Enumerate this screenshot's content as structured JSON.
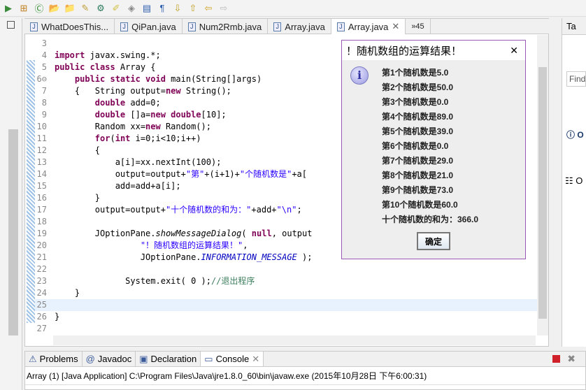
{
  "toolbar": {
    "icons": [
      "run-icon",
      "new-package-icon",
      "new-class-icon",
      "open-folder-icon",
      "open-type-icon",
      "search-icon",
      "debug-icon",
      "highlight-icon",
      "annotation-icon",
      "show-whitespace-icon",
      "next-annotation-icon",
      "prev-annotation-icon",
      "last-edit-icon",
      "back-icon",
      "forward-icon"
    ]
  },
  "editor": {
    "tabs": [
      {
        "label": "WhatDoesThis..."
      },
      {
        "label": "QiPan.java"
      },
      {
        "label": "Num2Rmb.java"
      },
      {
        "label": "Array.java"
      },
      {
        "label": "Array.java",
        "active": true
      }
    ],
    "overflow": "»45",
    "lines": [
      {
        "n": "3",
        "html": ""
      },
      {
        "n": "4",
        "html": "<span class='kw'>import</span> javax.swing.*;"
      },
      {
        "n": "5",
        "html": "<span class='kw'>public class</span> Array {"
      },
      {
        "n": "6⊖",
        "html": "    <span class='kw'>public static void</span> main(String[]args)"
      },
      {
        "n": "7",
        "html": "    {   String output=<span class='kw'>new</span> String();"
      },
      {
        "n": "8",
        "html": "        <span class='kw'>double</span> add=0;"
      },
      {
        "n": "9",
        "html": "        <span class='kw'>double</span> []a=<span class='kw'>new double</span>[10];"
      },
      {
        "n": "10",
        "html": "        Random xx=<span class='kw'>new</span> Random();"
      },
      {
        "n": "11",
        "html": "        <span class='kw'>for</span>(<span class='kw'>int</span> i=0;i&lt;10;i++)"
      },
      {
        "n": "12",
        "html": "        {"
      },
      {
        "n": "13",
        "html": "            a[i]=xx.nextInt(100);"
      },
      {
        "n": "14",
        "html": "            output=output+<span class='str'>\"第\"</span>+(i+1)+<span class='str'>\"个随机数是\"</span>+a["
      },
      {
        "n": "15",
        "html": "            add=add+a[i];"
      },
      {
        "n": "16",
        "html": "        }"
      },
      {
        "n": "17",
        "html": "        output=output+<span class='str'>\"十个随机数的和为：\"</span>+add+<span class='str'>\"\\n\"</span>;"
      },
      {
        "n": "18",
        "html": ""
      },
      {
        "n": "19",
        "html": "        JOptionPane.<span class='it'>showMessageDialog</span>( <span class='kw'>null</span>, output"
      },
      {
        "n": "20",
        "html": "                 <span class='str'>\"！随机数组的运算结果！\"</span>,"
      },
      {
        "n": "21",
        "html": "                 JOptionPane.<span class='fld'>INFORMATION_MESSAGE</span> );"
      },
      {
        "n": "22",
        "html": ""
      },
      {
        "n": "23",
        "html": "              System.exit( 0 );<span class='cm'>//退出程序</span>"
      },
      {
        "n": "24",
        "html": "    }"
      },
      {
        "n": "25",
        "html": "",
        "current": true
      },
      {
        "n": "26",
        "html": "}"
      },
      {
        "n": "27",
        "html": ""
      }
    ]
  },
  "dialog": {
    "title": "！随机数组的运算结果！",
    "close": "✕",
    "messages": [
      "第1个随机数是5.0",
      "第2个随机数是50.0",
      "第3个随机数是0.0",
      "第4个随机数是89.0",
      "第5个随机数是39.0",
      "第6个随机数是0.0",
      "第7个随机数是29.0",
      "第8个随机数是21.0",
      "第9个随机数是73.0",
      "第10个随机数是60.0",
      "十个随机数的和为：366.0"
    ],
    "ok": "确定"
  },
  "right_panel": {
    "tab": "Ta",
    "find": "Find",
    "info": "O",
    "outline": "O"
  },
  "bottom": {
    "tabs": [
      {
        "label": "Problems"
      },
      {
        "label": "Javadoc"
      },
      {
        "label": "Declaration"
      },
      {
        "label": "Console",
        "active": true
      }
    ],
    "console_line": "Array (1) [Java Application] C:\\Program Files\\Java\\jre1.8.0_60\\bin\\javaw.exe (2015年10月28日 下午6:00:31)"
  }
}
